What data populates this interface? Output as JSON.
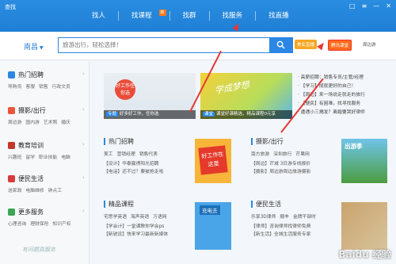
{
  "app": {
    "title": "查找"
  },
  "nav": [
    {
      "label": "找人"
    },
    {
      "label": "找课程",
      "badge": "新"
    },
    {
      "label": "找群"
    },
    {
      "label": "找服务"
    },
    {
      "label": "找直播"
    }
  ],
  "window_controls": [
    "□",
    "≡",
    "—",
    "✕"
  ],
  "search": {
    "city": "南昌",
    "placeholder": "旅游出行，轻松选择！"
  },
  "chips": [
    "美女直播",
    "腾讯课堂",
    "周边游"
  ],
  "sidebar": [
    {
      "title": "热门招聘",
      "links": [
        "导购员",
        "客服",
        "销售",
        "行政文员"
      ],
      "icon_color": "#2b87e3"
    },
    {
      "title": "摄影/出行",
      "links": [
        "周边游",
        "国内游",
        "艺术照",
        "婚庆"
      ],
      "icon_color": "#e9563b"
    },
    {
      "title": "教育培训",
      "links": [
        "兴趣班",
        "留学",
        "职业技能",
        "电脑"
      ],
      "icon_color": "#c0392b"
    },
    {
      "title": "便民生活",
      "links": [
        "送家政",
        "电脑维修",
        "钟点工"
      ],
      "icon_color": "#d63a3a"
    },
    {
      "title": "更多服务",
      "links": [
        "心理咨询",
        "理财保险",
        "知识产权"
      ],
      "icon_color": "#3aa657"
    }
  ],
  "signature": "有问题真服务",
  "banners": [
    {
      "tag": "专题",
      "caption": "好多好工作，任你选",
      "sign": "好工作任你选"
    },
    {
      "tag": "课堂",
      "caption": "课堂好课精选，精品课程0元享",
      "script": "学成梦想"
    }
  ],
  "news": [
    "· 高薪招聘：销售专员/主管/经理",
    "· 【学习】成就更好的自己！",
    "· 【周边】来一场说走就走的旅行",
    "· 【便民】有困难，找寻找服务",
    "· 遭遇小三揭发？离婚要哭好律师"
  ],
  "sections": [
    {
      "title": "热门招聘",
      "tags": [
        "美工",
        "营销经理",
        "销售代表"
      ],
      "lines": [
        "【设计】华泰赢得阳光招聘",
        "【电话】还不过？要被抢走啦"
      ]
    },
    {
      "title": "摄影/出行",
      "tags": [
        "南方旅游",
        "深圳旅行",
        "芒果网"
      ],
      "lines": [
        "【周边】芒城 3日游专线报价",
        "【摄影】周边游周边旅游摄影"
      ]
    },
    {
      "title": "精品课程",
      "tags": [
        "宅思学英语",
        "海声英语",
        "万语网"
      ],
      "lines": [
        "【学会计】一堂课教你学会ps",
        "【新锐设】快来学习最新新媒体"
      ]
    },
    {
      "title": "便民生活",
      "tags": [
        "乐享3D律师",
        "顺丰",
        "金牌干部时"
      ],
      "lines": [
        "【律师】咨询律师找律师免费",
        "【新生活】全城生活服务专家"
      ]
    }
  ],
  "posters": {
    "p1": "好工作在这里",
    "p2": "充电去",
    "p3": "出游季"
  },
  "watermark": "Baidu 经验"
}
